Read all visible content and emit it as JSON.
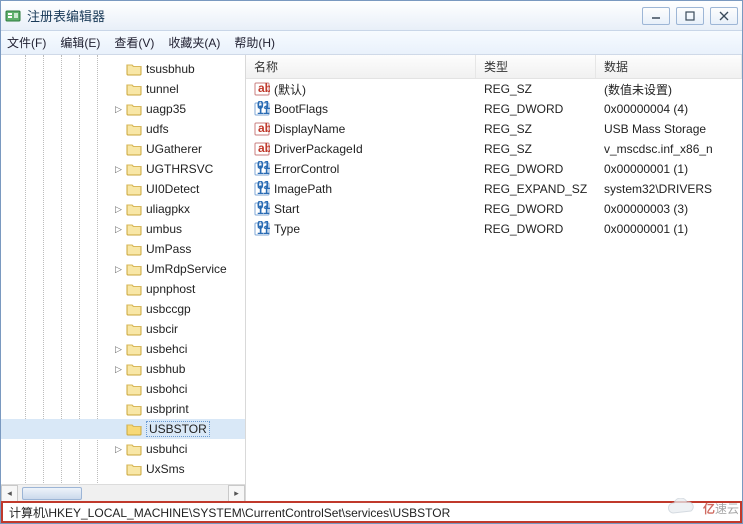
{
  "window": {
    "title": "注册表编辑器"
  },
  "menu": {
    "file": "文件(F)",
    "edit": "编辑(E)",
    "view": "查看(V)",
    "favorites": "收藏夹(A)",
    "help": "帮助(H)"
  },
  "tree": {
    "items": [
      {
        "label": "tsusbhub",
        "exp": ""
      },
      {
        "label": "tunnel",
        "exp": ""
      },
      {
        "label": "uagp35",
        "exp": "▷"
      },
      {
        "label": "udfs",
        "exp": ""
      },
      {
        "label": "UGatherer",
        "exp": ""
      },
      {
        "label": "UGTHRSVC",
        "exp": "▷"
      },
      {
        "label": "UI0Detect",
        "exp": ""
      },
      {
        "label": "uliagpkx",
        "exp": "▷"
      },
      {
        "label": "umbus",
        "exp": "▷"
      },
      {
        "label": "UmPass",
        "exp": ""
      },
      {
        "label": "UmRdpService",
        "exp": "▷"
      },
      {
        "label": "upnphost",
        "exp": ""
      },
      {
        "label": "usbccgp",
        "exp": ""
      },
      {
        "label": "usbcir",
        "exp": ""
      },
      {
        "label": "usbehci",
        "exp": "▷"
      },
      {
        "label": "usbhub",
        "exp": "▷"
      },
      {
        "label": "usbohci",
        "exp": ""
      },
      {
        "label": "usbprint",
        "exp": ""
      },
      {
        "label": "USBSTOR",
        "exp": "",
        "selected": true
      },
      {
        "label": "usbuhci",
        "exp": "▷"
      },
      {
        "label": "UxSms",
        "exp": ""
      }
    ]
  },
  "list": {
    "columns": {
      "name": "名称",
      "type": "类型",
      "data": "数据"
    },
    "rows": [
      {
        "icon": "str",
        "name": "(默认)",
        "type": "REG_SZ",
        "data": "(数值未设置)"
      },
      {
        "icon": "bin",
        "name": "BootFlags",
        "type": "REG_DWORD",
        "data": "0x00000004 (4)"
      },
      {
        "icon": "str",
        "name": "DisplayName",
        "type": "REG_SZ",
        "data": "USB Mass Storage"
      },
      {
        "icon": "str",
        "name": "DriverPackageId",
        "type": "REG_SZ",
        "data": "v_mscdsc.inf_x86_n"
      },
      {
        "icon": "bin",
        "name": "ErrorControl",
        "type": "REG_DWORD",
        "data": "0x00000001 (1)"
      },
      {
        "icon": "bin",
        "name": "ImagePath",
        "type": "REG_EXPAND_SZ",
        "data": "system32\\DRIVERS"
      },
      {
        "icon": "bin",
        "name": "Start",
        "type": "REG_DWORD",
        "data": "0x00000003 (3)"
      },
      {
        "icon": "bin",
        "name": "Type",
        "type": "REG_DWORD",
        "data": "0x00000001 (1)"
      }
    ]
  },
  "status": {
    "path": "计算机\\HKEY_LOCAL_MACHINE\\SYSTEM\\CurrentControlSet\\services\\USBSTOR"
  },
  "watermark": {
    "a": "亿",
    "b": "速云"
  }
}
